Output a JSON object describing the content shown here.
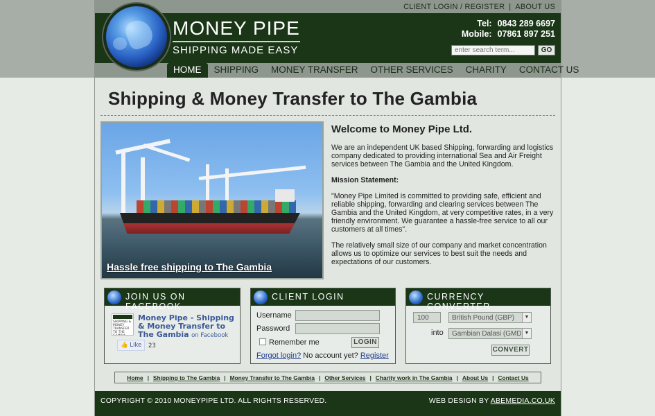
{
  "header": {
    "top_links": {
      "login_register": "CLIENT LOGIN / REGISTER",
      "separator": "|",
      "about": "ABOUT US"
    },
    "brand": {
      "name": "MONEY PIPE",
      "tagline": "SHIPPING MADE EASY"
    },
    "contact": {
      "tel_label": "Tel:",
      "tel": "0843 289 6697",
      "mobile_label": "Mobile:",
      "mobile": "07861 897 251"
    },
    "search": {
      "placeholder": "enter search term...",
      "button": "GO"
    },
    "nav": [
      "HOME",
      "SHIPPING",
      "MONEY TRANSFER",
      "OTHER SERVICES",
      "CHARITY",
      "CONTACT US"
    ],
    "active_nav": "HOME"
  },
  "main": {
    "title": "Shipping & Money Transfer to The Gambia",
    "hero_caption": "Hassle free shipping to The Gambia",
    "welcome": {
      "heading": "Welcome to Money Pipe Ltd.",
      "intro": "We are an independent UK based Shipping, forwarding and logistics company dedicated to providing international Sea and Air Freight services between The Gambia and the United Kingdom.",
      "mission_heading": "Mission Statement:",
      "mission": "\"Money Pipe Limited is committed to providing safe, efficient and reliable shipping, forwarding and clearing services between The Gambia and the United Kingdom, at very competitive rates, in a very friendly environment. We guarantee a hassle-free service to all our customers at all times\".",
      "closing": "The relatively small size of our company and market concentration allows us to optimize our services to best suit the needs and expectations of our customers."
    }
  },
  "facebook": {
    "heading": "JOIN US ON FACEBOOK",
    "page_name": "Money Pipe - Shipping & Money Transfer to The Gambia",
    "on_facebook": "on Facebook",
    "like_label": "Like",
    "like_count": "23",
    "thumb_text": "SHIPPING & MONEY TRANSFER TO THE GAMBIA"
  },
  "client_login": {
    "heading": "CLIENT LOGIN",
    "username_label": "Username",
    "password_label": "Password",
    "remember_label": "Remember me",
    "login_button": "LOGIN",
    "forgot": "Forgot login?",
    "no_account": "No account yet?",
    "register": "Register"
  },
  "converter": {
    "heading": "CURRENCY CONVERTER",
    "amount": "100",
    "from": "British Pound (GBP)",
    "into_label": "into",
    "to": "Gambian Dalasi (GMD)",
    "button": "CONVERT"
  },
  "footer_links": [
    "Home",
    "Shipping to The Gambia",
    "Money Transfer to The Gambia",
    "Other Services",
    "Charity work in The Gambia",
    "About Us",
    "Contact Us"
  ],
  "footer_sep": "|",
  "footer": {
    "copyright": "COPYRIGHT © 2010 MONEYPIPE LTD. ALL RIGHTS RESERVED.",
    "design_prefix": "WEB DESIGN BY",
    "design_link": "ABEMEDIA.CO.UK"
  },
  "colors": {
    "dark_green": "#1b3617",
    "header_grey": "#8e978e",
    "link_blue": "#1b3a8a"
  }
}
